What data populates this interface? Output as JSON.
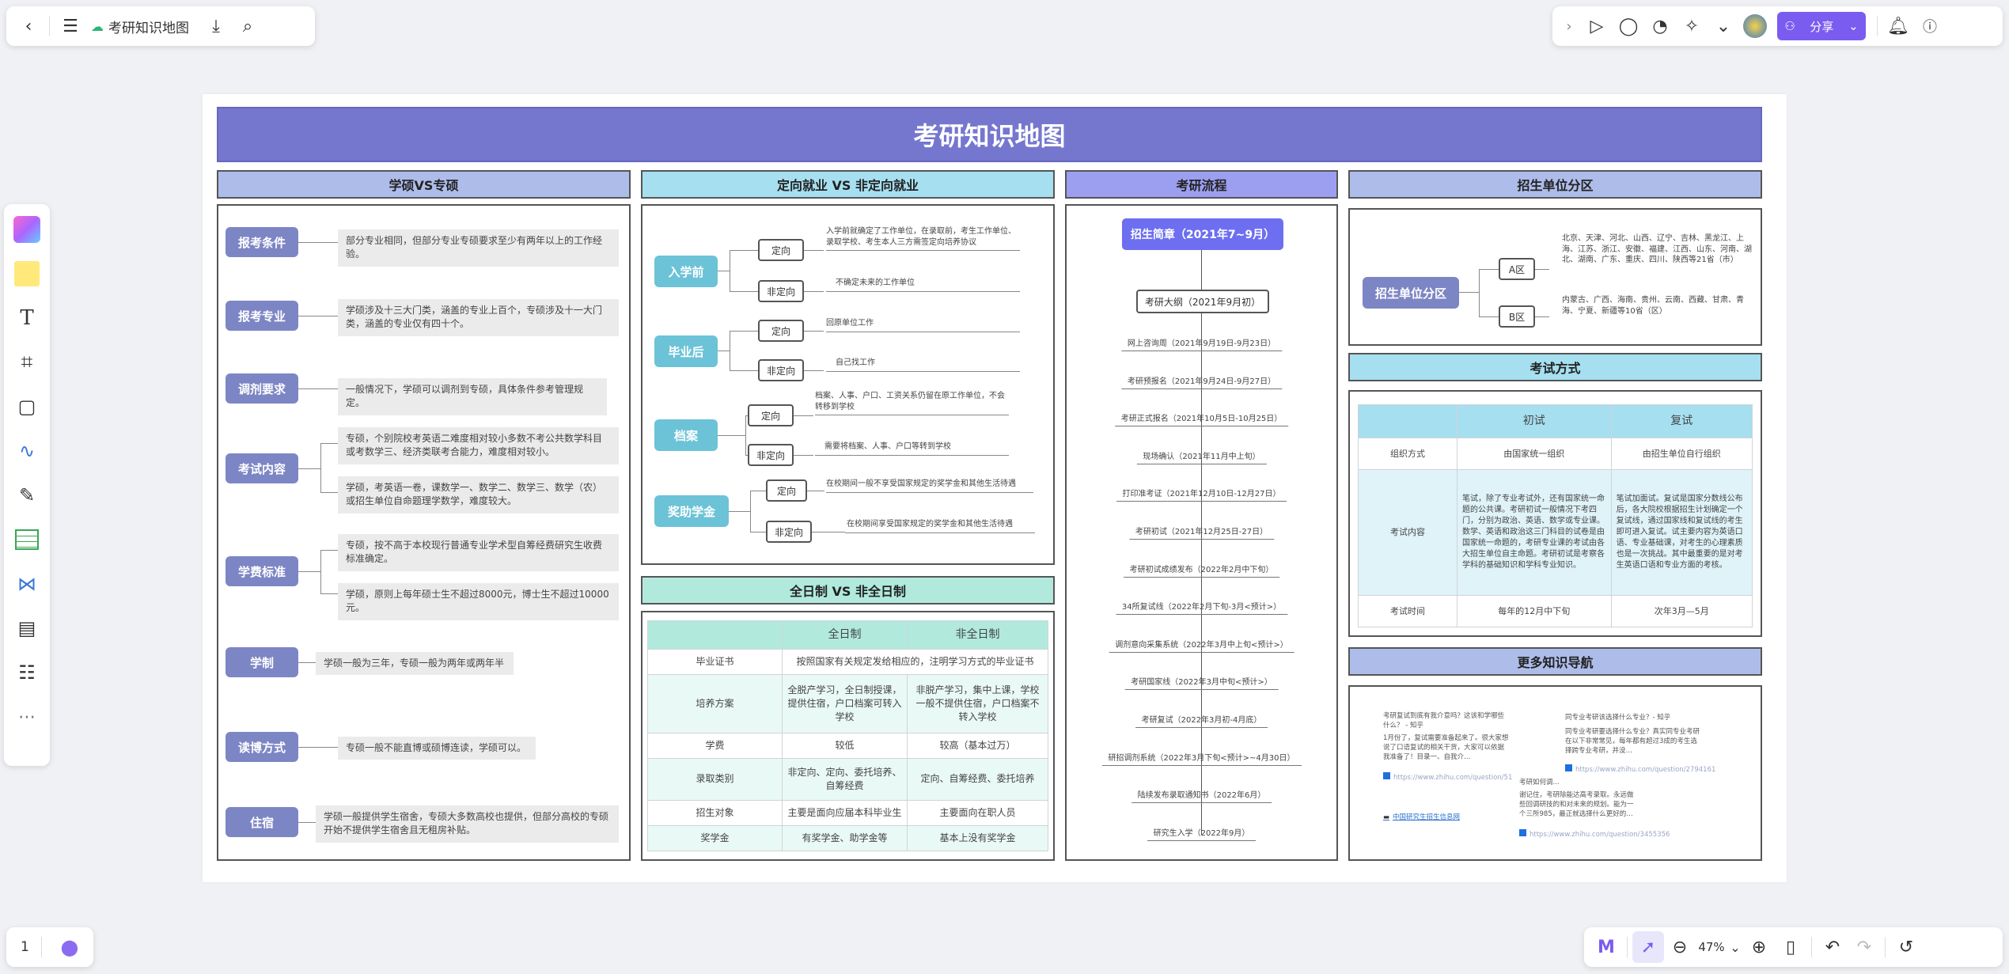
{
  "topbar": {
    "title": "考研知识地图",
    "share_label": "分享"
  },
  "page_number": "1",
  "zoom": "47%",
  "mindmap": {
    "title": "考研知识地图",
    "col1": {
      "header": "学硕VS专硕",
      "items": [
        {
          "label": "报考条件",
          "notes": [
            "部分专业相同，但部分专业专硕要求至少有两年以上的工作经验。"
          ]
        },
        {
          "label": "报考专业",
          "notes": [
            "学硕涉及十三大门类，涵盖的专业上百个，专硕涉及十一大门类，涵盖的专业仅有四十个。"
          ]
        },
        {
          "label": "调剂要求",
          "notes": [
            "一般情况下，学硕可以调剂到专硕，具体条件参考管理规定。"
          ]
        },
        {
          "label": "考试内容",
          "notes": [
            "专硕，个别院校考英语二难度相对较小多数不考公共数学科目或考数学三、经济类联考合能力，难度相对较小。",
            "学硕，考英语一卷，课数学一、数学二、数学三、数学（农）或招生单位自命题理学数学，难度较大。"
          ]
        },
        {
          "label": "学费标准",
          "notes": [
            "专硕，按不高于本校现行普通专业学术型自筹经费研究生收费标准确定。",
            "学硕，原则上每年硕士生不超过8000元，博士生不超过10000元。"
          ]
        },
        {
          "label": "学制",
          "notes": [
            "学硕一般为三年，专硕一般为两年或两年半"
          ]
        },
        {
          "label": "读博方式",
          "notes": [
            "专硕一般不能直博或硕博连读，学硕可以。"
          ]
        },
        {
          "label": "住宿",
          "notes": [
            "学硕一般提供学生宿舍，专硕大多数高校也提供，但部分高校的专硕开始不提供学生宿舍且无租房补贴。"
          ]
        }
      ]
    },
    "col2": {
      "header": "定向就业 VS 非定向就业",
      "groups": [
        {
          "label": "入学前",
          "branches": [
            {
              "node": "定向",
              "text": "入学前就确定了工作单位，在录取前，考生工作单位、录取学校、考生本人三方需签定向培养协议"
            },
            {
              "node": "非定向",
              "text": "不确定未来的工作单位"
            }
          ]
        },
        {
          "label": "毕业后",
          "branches": [
            {
              "node": "定向",
              "text": "回原单位工作"
            },
            {
              "node": "非定向",
              "text": "自己找工作"
            }
          ]
        },
        {
          "label": "档案",
          "branches": [
            {
              "node": "定向",
              "text": "档案、人事、户口、工资关系仍留在原工作单位，不会转移到学校"
            },
            {
              "node": "非定向",
              "text": "需要将档案、人事、户口等转到学校"
            }
          ]
        },
        {
          "label": "奖助学金",
          "branches": [
            {
              "node": "定向",
              "text": "在校期间一般不享受国家规定的奖学金和其他生活待遇"
            },
            {
              "node": "非定向",
              "text": "在校期间享受国家规定的奖学金和其他生活待遇"
            }
          ]
        }
      ]
    },
    "col2b": {
      "header": "全日制 VS 非全日制",
      "table": {
        "headers": [
          "",
          "全日制",
          "非全日制"
        ],
        "rows": [
          [
            "毕业证书",
            "按照国家有关规定发给相应的，注明学习方式的毕业证书"
          ],
          [
            "培养方案",
            "全脱产学习，全日制授课，提供住宿，户口档案可转入学校",
            "非脱产学习，集中上课，学校一般不提供住宿，户口档案不转入学校"
          ],
          [
            "学费",
            "较低",
            "较高（基本过万）"
          ],
          [
            "录取类别",
            "非定向、定向、委托培养、自筹经费",
            "定向、自筹经费、委托培养"
          ],
          [
            "招生对象",
            "主要是面向应届本科毕业生",
            "主要面向在职人员"
          ],
          [
            "奖学金",
            "有奖学金、助学金等",
            "基本上没有奖学金"
          ]
        ]
      }
    },
    "col3": {
      "header": "考研流程",
      "start": "招生简章（2021年7~9月）",
      "outline": "考研大纲（2021年9月初）",
      "steps": [
        "网上咨询周（2021年9月19日-9月23日）",
        "考研预报名（2021年9月24日-9月27日）",
        "考研正式报名（2021年10月5日-10月25日）",
        "现场确认（2021年11月中上旬）",
        "打印准考证（2021年12月10日-12月27日）",
        "考研初试（2021年12月25日-27日）",
        "考研初试成绩发布（2022年2月中下旬）",
        "34所复试线（2022年2月下旬-3月<预计>）",
        "调剂意向采集系统（2022年3月中上旬<预计>）",
        "考研国家线（2022年3月中旬<预计>）",
        "考研复试（2022年3月初-4月底）",
        "研招调剂系统（2022年3月下旬<预计>~4月30日）",
        "陆续发布录取通知书（2022年6月）",
        "研究生入学（2022年9月）"
      ]
    },
    "col4": {
      "header": "招生单位分区",
      "root": "招生单位分区",
      "zones": [
        {
          "node": "A区",
          "text": "北京、天津、河北、山西、辽宁、吉林、黑龙江、上海、江苏、浙江、安徽、福建、江西、山东、河南、湖北、湖南、广东、重庆、四川、陕西等21省（市）"
        },
        {
          "node": "B区",
          "text": "内蒙古、广西、海南、贵州、云南、西藏、甘肃、青海、宁夏、新疆等10省（区）"
        }
      ],
      "exam_header": "考试方式",
      "exam_table": {
        "headers": [
          "",
          "初试",
          "复试"
        ],
        "rows": [
          [
            "组织方式",
            "由国家统一组织",
            "由招生单位自行组织"
          ],
          [
            "考试内容",
            "笔试，除了专业考试外，还有国家统一命题的公共课。考研初试一般情况下考四门，分别为政治、英语、数学或专业课。数学、英语和政治这三门科目的试卷是由国家统一命题的，考研专业课的考试由各大招生单位自主命题。考研初试是考察各学科的基础知识和学科专业知识。",
            "笔试加面试。复试是国家分数线公布后，各大院校根据招生计划确定一个复试线，通过国家线和复试线的考生即可进入复试。试主要内容为英语口语、专业基础课，对考生的心理素质也是一次挑战。其中最重要的是对考生英语口语和专业方面的考核。"
          ],
          [
            "考试时间",
            "每年的12月中下旬",
            "次年3月—5月"
          ]
        ]
      },
      "nav_header": "更多知识导航",
      "nav": {
        "q1": "考研复试到底有我介意吗？这该和学哪些什么？ - 知乎",
        "q1b": "1月份了，复试需要准备起来了。很大家想说了口语复试的相关干货，大家可以依据我准备了！目录一、自我介…",
        "q1link": "https://www.zhihu.com/question/51",
        "q2": "同专业考研该选择什么专业？- 知乎",
        "q2b": "同专业考研要选择什么专业？真实同专业考研在以下非常常见，每年都有超过3成的考生选择跨专业考研，并没…",
        "q2link": "https://www.zhihu.com/question/2794161",
        "q3": "考研如何调...",
        "q3b": "谢记住，考研除能达高考录取。永远做些回调研技的和对未来的规划。能为一个三所985，最正就选择什么更好的…",
        "q3link": "https://www.zhihu.com/question/3455356",
        "site": "中国研究生招生信息网"
      }
    }
  }
}
